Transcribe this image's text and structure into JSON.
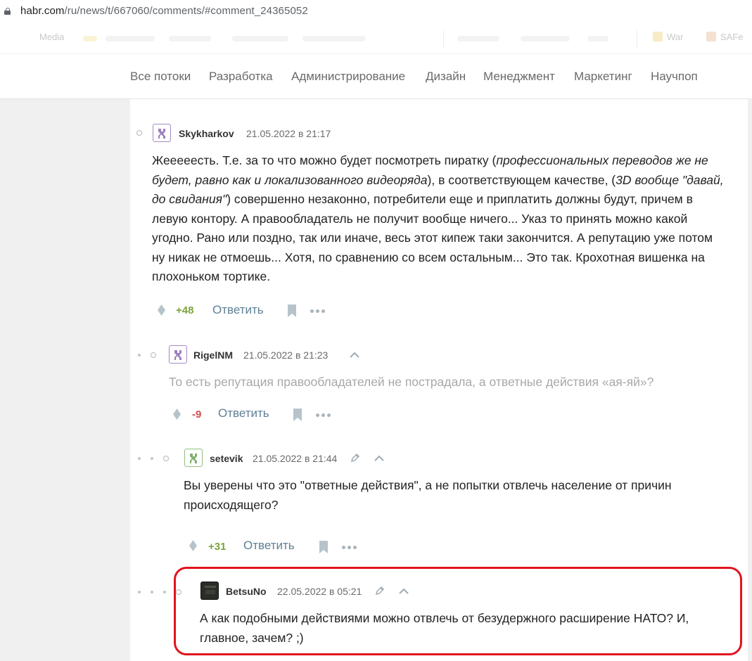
{
  "browser": {
    "url_host": "habr.com",
    "url_path": "/ru/news/t/667060/comments/#comment_24365052",
    "bookmarks": [
      {
        "label": "Media"
      },
      {
        "label": "War"
      },
      {
        "label": "SAFe"
      }
    ]
  },
  "nav": {
    "items": [
      "Все потоки",
      "Разработка",
      "Администрирование",
      "Дизайн",
      "Менеджмент",
      "Маркетинг",
      "Научпоп"
    ]
  },
  "comments": [
    {
      "author": "Skykharkov",
      "date": "21.05.2022 в 21:17",
      "text_parts": [
        "Жееееесть. Т.е. за то что можно будет посмотреть пиратку (",
        "профессиональных переводов же не будет, равно как и локализованного видеоряда",
        "), в соответствующем качестве, (",
        "3D вообще \"давай, до свидания\"",
        ") совершенно незаконно, потребители еще и приплатить должны будут, причем в левую контору. А правообладатель не получит вообще ничего... Указ то принять можно какой угодно. Рано или поздно, так или иначе, весь этот кипеж таки закончится. А репутацию уже потом ну никак не отмоешь... Хотя, по сравнению со всем остальным... Это так. Крохотная вишенка на плохоньком тортике."
      ],
      "score": "+48",
      "reply_label": "Ответить"
    },
    {
      "author": "RigelNM",
      "date": "21.05.2022 в 21:23",
      "text": "То есть репутация правообладателей не пострадала, а ответные действия «ая-яй»?",
      "score": "-9",
      "reply_label": "Ответить"
    },
    {
      "author": "setevik",
      "date": "21.05.2022 в 21:44",
      "text": "Вы уверены что это \"ответные действия\", а не попытки отвлечь население от причин происходящего?",
      "score": "+31",
      "reply_label": "Ответить"
    },
    {
      "author": "BetsuNo",
      "date": "22.05.2022 в 05:21",
      "text": "А как подобными действиями можно отвлечь от безудержного расширение НАТО? И, главное, зачем? ;)"
    }
  ],
  "colors": {
    "highlight": "#e0141e",
    "score_positive": "#7ca33d",
    "score_negative": "#d44c4c",
    "reply_link": "#5e8096"
  }
}
